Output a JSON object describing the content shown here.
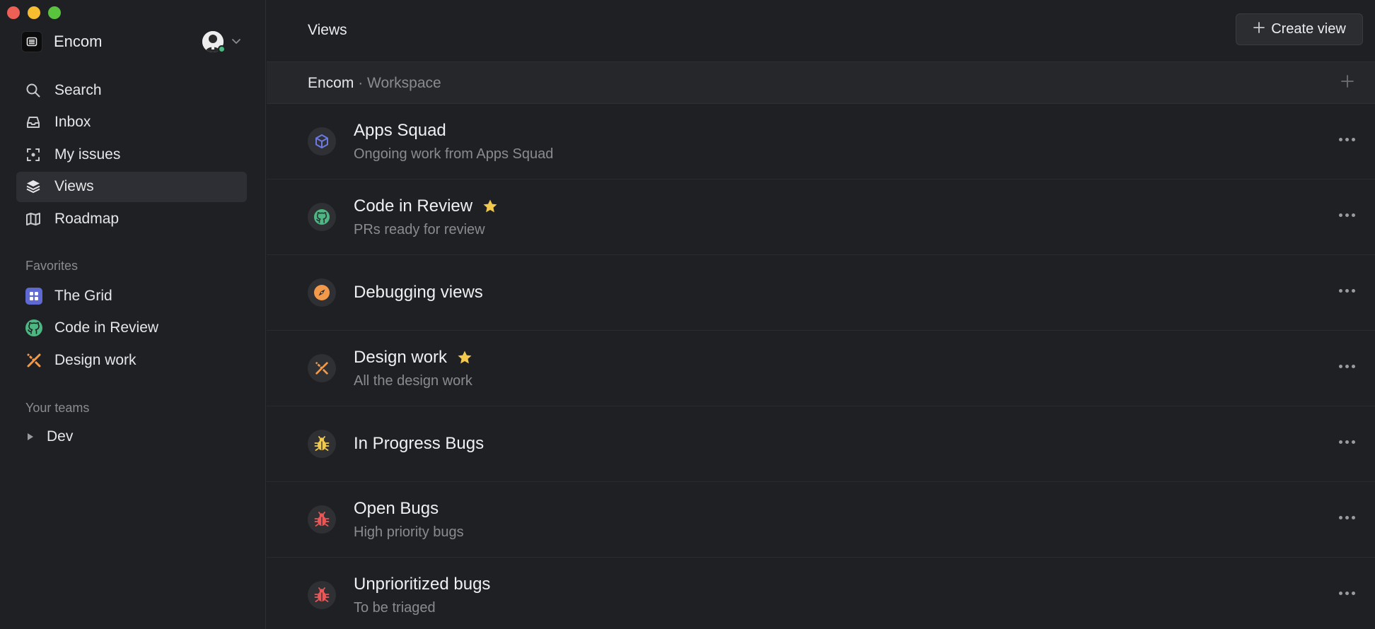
{
  "window": {
    "controls": [
      "close",
      "minimize",
      "zoom"
    ]
  },
  "workspace": {
    "name": "Encom",
    "icon": "workspace-logo-icon",
    "status_color": "#4cb782"
  },
  "nav": {
    "items": [
      {
        "label": "Search",
        "icon": "search-icon"
      },
      {
        "label": "Inbox",
        "icon": "inbox-icon"
      },
      {
        "label": "My issues",
        "icon": "my-issues-icon"
      },
      {
        "label": "Views",
        "icon": "layers-icon",
        "active": true
      },
      {
        "label": "Roadmap",
        "icon": "map-icon"
      }
    ]
  },
  "favorites": {
    "heading": "Favorites",
    "items": [
      {
        "label": "The Grid",
        "icon": "grid-icon",
        "color": "#5e6ad2"
      },
      {
        "label": "Code in Review",
        "icon": "github-icon",
        "color": "#4cb782"
      },
      {
        "label": "Design work",
        "icon": "design-tools-icon",
        "color": "#f2994a"
      }
    ]
  },
  "teams": {
    "heading": "Your teams",
    "items": [
      {
        "label": "Dev",
        "icon": "disclosure-triangle-icon"
      }
    ]
  },
  "header": {
    "title": "Views",
    "create_label": "Create view"
  },
  "group": {
    "name": "Encom",
    "separator": " · ",
    "type": "Workspace"
  },
  "views": [
    {
      "title": "Apps Squad",
      "subtitle": "Ongoing work from Apps Squad",
      "icon": "cube-icon",
      "color": "#6c79e0",
      "starred": false
    },
    {
      "title": "Code in Review",
      "subtitle": "PRs ready for review",
      "icon": "github-icon",
      "color": "#4cb782",
      "starred": true
    },
    {
      "title": "Debugging views",
      "subtitle": "",
      "icon": "compass-icon",
      "color": "#f2994a",
      "starred": false
    },
    {
      "title": "Design work",
      "subtitle": "All the design work",
      "icon": "design-tools-icon",
      "color": "#f2994a",
      "starred": true
    },
    {
      "title": "In Progress Bugs",
      "subtitle": "",
      "icon": "bug-icon",
      "color": "#f2c94c",
      "starred": false
    },
    {
      "title": "Open Bugs",
      "subtitle": "High priority bugs",
      "icon": "bug-icon",
      "color": "#eb5757",
      "starred": false
    },
    {
      "title": "Unprioritized bugs",
      "subtitle": "To be triaged",
      "icon": "bug-icon",
      "color": "#eb5757",
      "starred": false
    }
  ],
  "colors": {
    "star": "#f2c94c",
    "background": "#1f2023",
    "active_nav": "#2e2f34"
  }
}
